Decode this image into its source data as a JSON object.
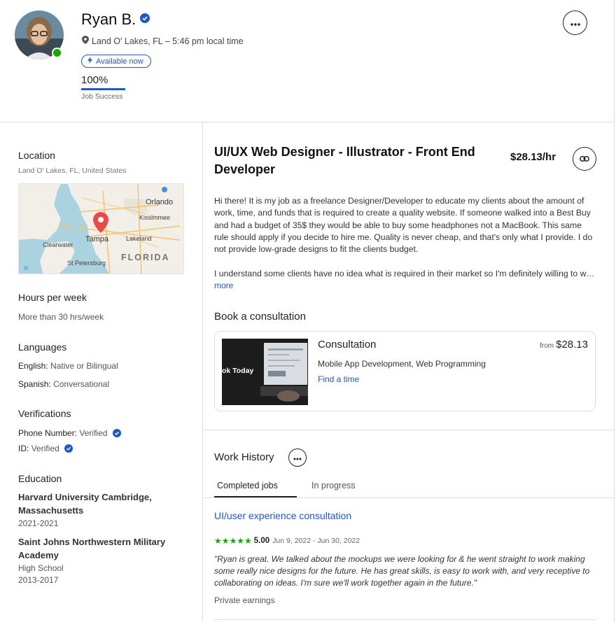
{
  "profile": {
    "name": "Ryan B.",
    "location_time": "Land O' Lakes, FL – 5:46 pm local time",
    "availability": "Available now",
    "job_success_value": "100%",
    "job_success_label": "Job Success"
  },
  "sidebar": {
    "location_heading": "Location",
    "location_value": "Land O' Lakes, FL, United States",
    "map_labels": {
      "orlando": "Orlando",
      "kissimmee": "Kissimmee",
      "tampa": "Tampa",
      "lakeland": "Lakeland",
      "clearwater": "Clearwater",
      "st_petersburg": "St Petersburg",
      "florida": "FLORIDA"
    },
    "hours_heading": "Hours per week",
    "hours_value": "More than 30 hrs/week",
    "languages_heading": "Languages",
    "languages": [
      {
        "name": "English",
        "level": "Native or Bilingual"
      },
      {
        "name": "Spanish",
        "level": "Conversational"
      }
    ],
    "verifications_heading": "Verifications",
    "verifications": [
      {
        "name": "Phone Number",
        "status": "Verified"
      },
      {
        "name": "ID",
        "status": "Verified"
      }
    ],
    "education_heading": "Education",
    "education": [
      {
        "school": "Harvard University Cambridge, Massachusetts",
        "degree": "",
        "years": "2021-2021"
      },
      {
        "school": "Saint Johns Northwestern Military Academy",
        "degree": "High School",
        "years": "2013-2017"
      }
    ]
  },
  "main": {
    "title": "UI/UX Web Designer - Illustrator - Front End Developer",
    "rate": "$28.13/hr",
    "description_p1": "Hi there! It is my job as a freelance Designer/Developer to educate my clients about the amount of work, time, and funds that is required to create a quality website. If someone walked into a Best Buy and had a budget of 35$ they would be able to buy some headphones not a MacBook. This same rule should apply if you decide to hire me. Quality is never cheap, and that's only what I provide. I do not provide low-grade designs to fit the clients budget.",
    "description_p2": "I understand some clients have no idea what is required in their market so I'm definitely willing to work with you to educate you on what you need.",
    "more_link": "more",
    "book_heading": "Book a consultation",
    "consultation": {
      "image_text": "ok Today",
      "name": "Consultation",
      "price_prefix": "from",
      "price": "$28.13",
      "skills": "Mobile App Development, Web Programming",
      "link": "Find a time"
    },
    "work_history": {
      "heading": "Work History",
      "tabs": [
        "Completed jobs",
        "In progress"
      ],
      "job": {
        "title": "UI/user experience consultation",
        "stars": "★★★★★",
        "score": "5.00",
        "dates": "Jun 9, 2022 - Jun 30, 2022",
        "review": "\"Ryan is great. We talked about the mockups we were looking for & he went straight to work making some really nice designs for the future. He has great skills, is easy to work with, and very receptive to collaborating on ideas. I'm sure we'll work together again in the future.\"",
        "earnings": "Private earnings"
      }
    }
  },
  "colors": {
    "accent_blue": "#1f57c3",
    "online_green": "#14a800",
    "star_green": "#14a800"
  },
  "icons": {
    "verified": "verified-badge-icon",
    "location": "map-pin-icon",
    "lightning": "lightning-icon",
    "more": "ellipsis-icon",
    "link": "link-icon"
  }
}
